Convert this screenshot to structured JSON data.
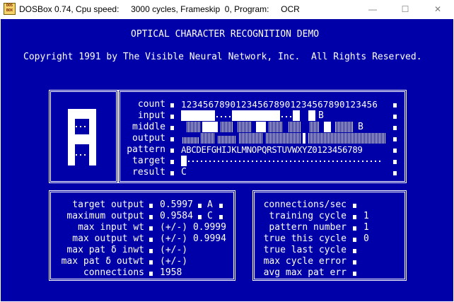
{
  "window": {
    "title": "DOSBox 0.74, Cpu speed:     3000 cycles, Frameskip  0, Program:     OCR",
    "icon_text": "DOS BOX",
    "controls": {
      "minimize": "—",
      "maximize": "☐",
      "close": "✕"
    }
  },
  "header": {
    "title": "OPTICAL CHARACTER RECOGNITION DEMO",
    "copyright": "Copyright 1991 by The Visible Neural Network, Inc.  All Rights Reserved."
  },
  "network": {
    "labels": [
      "count",
      "input",
      "middle",
      "output",
      "pattern",
      "target",
      "result"
    ],
    "count": "123456789012345678901234567890123456",
    "input_end": "B",
    "middle_end": "B",
    "pattern": "ABCDEFGHIJKLMNOPQRSTUVWXYZ0123456789",
    "result": "C"
  },
  "output_stats": [
    {
      "label": "target output",
      "value": "0.5997",
      "char": "A"
    },
    {
      "label": "maximum output",
      "value": "0.9584",
      "char": "C"
    },
    {
      "label": "max input wt",
      "value": "(+/-) 0.9999",
      "char": ""
    },
    {
      "label": "max output wt",
      "value": "(+/-) 0.9994",
      "char": ""
    },
    {
      "label": "max pat δ inwt",
      "value": "(+/-)",
      "char": ""
    },
    {
      "label": "max pat δ outwt",
      "value": "(+/-)",
      "char": ""
    },
    {
      "label": "connections",
      "value": "1958",
      "char": ""
    }
  ],
  "training_stats": [
    {
      "label": "connections/sec",
      "value": ""
    },
    {
      "label": "training cycle",
      "value": "1"
    },
    {
      "label": "pattern number",
      "value": "1"
    },
    {
      "label": "true this cycle",
      "value": "0"
    },
    {
      "label": "true last cycle",
      "value": ""
    },
    {
      "label": "max cycle error",
      "value": ""
    },
    {
      "label": "avg max pat err",
      "value": ""
    }
  ],
  "colors": {
    "background": "#0000a8",
    "foreground": "#ffffff"
  }
}
